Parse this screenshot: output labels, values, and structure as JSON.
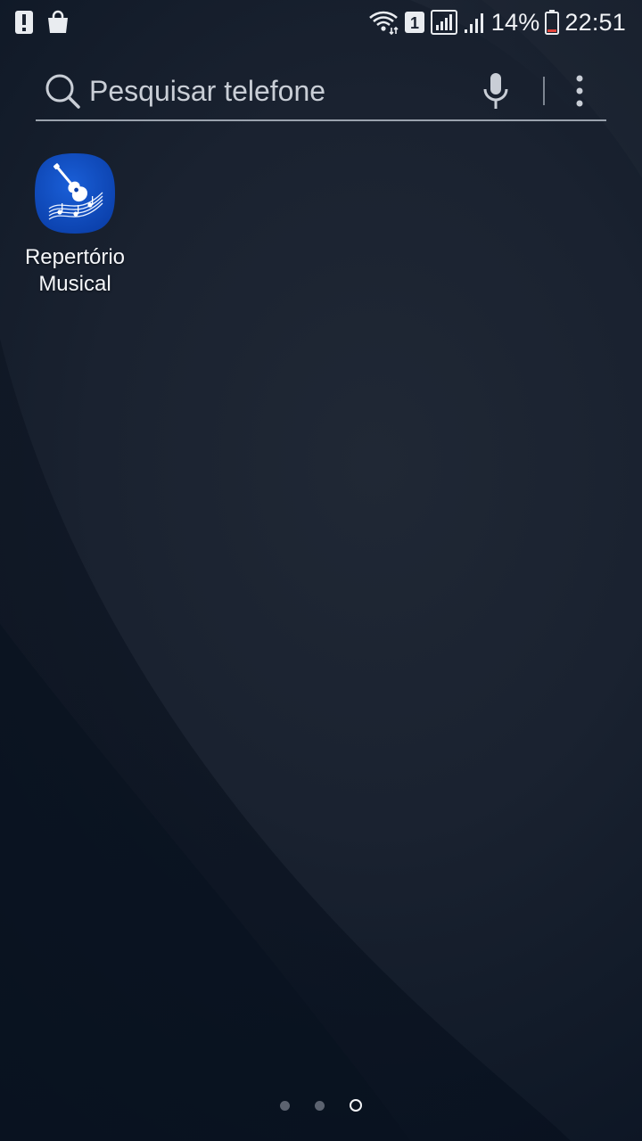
{
  "status_bar": {
    "notification_icons": [
      "alert-icon",
      "shopping-bag-icon"
    ],
    "system_icons": [
      "wifi-icon",
      "sim-1-icon",
      "signal-icon",
      "signal-2-icon",
      "battery-icon"
    ],
    "sim_number": "1",
    "battery_percent": "14%",
    "battery_level": 0.14,
    "time": "22:51"
  },
  "search": {
    "placeholder": "Pesquisar telefone",
    "icons": [
      "search-icon",
      "microphone-icon",
      "more-options-icon"
    ]
  },
  "apps": [
    {
      "label_line1": "Repertório",
      "label_line2": "Musical",
      "icon": "guitar-music-notes-icon",
      "icon_color": "#0b47b8"
    }
  ],
  "page_indicator": {
    "pages": 3,
    "current_page": 3
  },
  "colors": {
    "background": "#131b27",
    "accent_app": "#0b47b8",
    "battery_low": "#e2453c"
  }
}
